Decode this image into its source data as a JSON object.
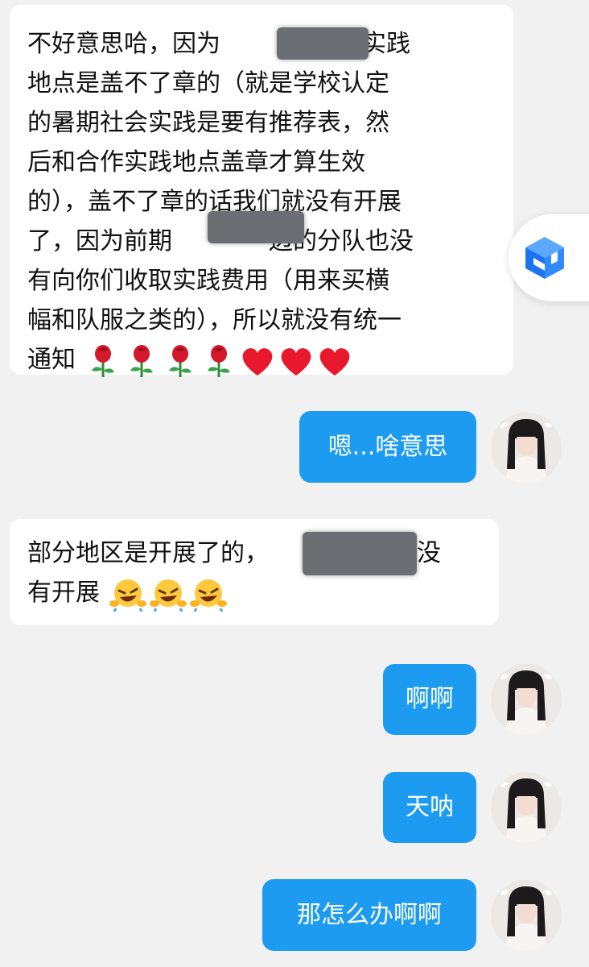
{
  "messages": [
    {
      "side": "received",
      "lines": [
        "不好意思哈，因为",
        "区的实践",
        "地点是盖不了章的（就是学校认定",
        "的暑期社会实践是要有推荐表，然",
        "后和合作实践地点盖章才算生效",
        "的），盖不了章的话我们就没有开展",
        "了，因为前期",
        "边的分队也没",
        "有向你们收取实践费用（用来买横",
        "幅和队服之类的），所以就没有统一",
        "通知"
      ],
      "trailing_emoji": [
        "rose",
        "rose",
        "rose",
        "rose",
        "heart",
        "heart",
        "heart"
      ]
    },
    {
      "side": "sent",
      "text": "嗯...啥意思"
    },
    {
      "side": "received",
      "lines": [
        "部分地区是开展了的，",
        "地区没",
        "有开展"
      ],
      "trailing_emoji": [
        "rofl",
        "rofl",
        "rofl"
      ]
    },
    {
      "side": "sent",
      "text": "啊啊"
    },
    {
      "side": "sent",
      "text": "天呐"
    },
    {
      "side": "sent",
      "text": "那怎么办啊啊"
    }
  ],
  "colors": {
    "background": "#f1f1f1",
    "sent_bubble": "#1d9bf0",
    "received_bubble": "#ffffff",
    "redaction": "#6b6e73"
  },
  "floating_button": {
    "icon": "cube-app-icon"
  }
}
